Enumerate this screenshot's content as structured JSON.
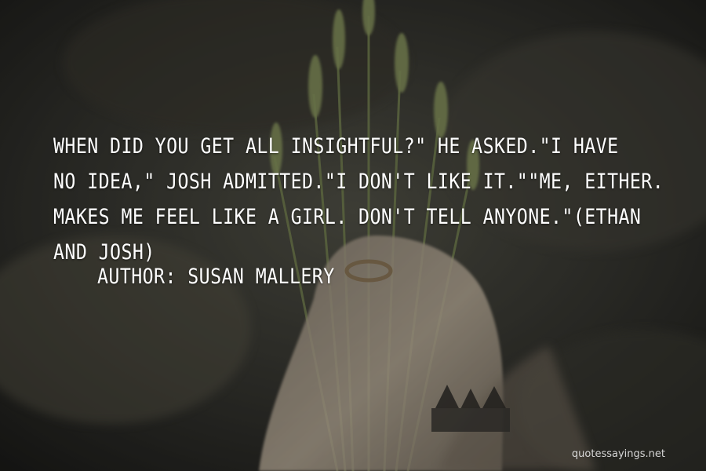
{
  "quote": {
    "lines": [
      "WHEN DID YOU GET ALL INSIGHTFUL?\" HE ASKED.\"I HAVE",
      "NO IDEA,\" JOSH ADMITTED.\"I DON'T LIKE IT.\"\"ME, EITHER.",
      "MAKES ME FEEL LIKE A GIRL. DON'T TELL ANYONE.\"(ETHAN",
      "AND JOSH)"
    ],
    "author_label": "AUTHOR: SUSAN MALLERY"
  },
  "watermark": "quotessayings.net",
  "colors": {
    "text": "#ffffff",
    "background_dark": "#1e1e1b",
    "background_mid": "#4a4a40",
    "hand_skin": "#c8b9a3",
    "grass_green": "#7e8f58"
  },
  "background_image": "hand holding grass stalks, dark blurred background"
}
